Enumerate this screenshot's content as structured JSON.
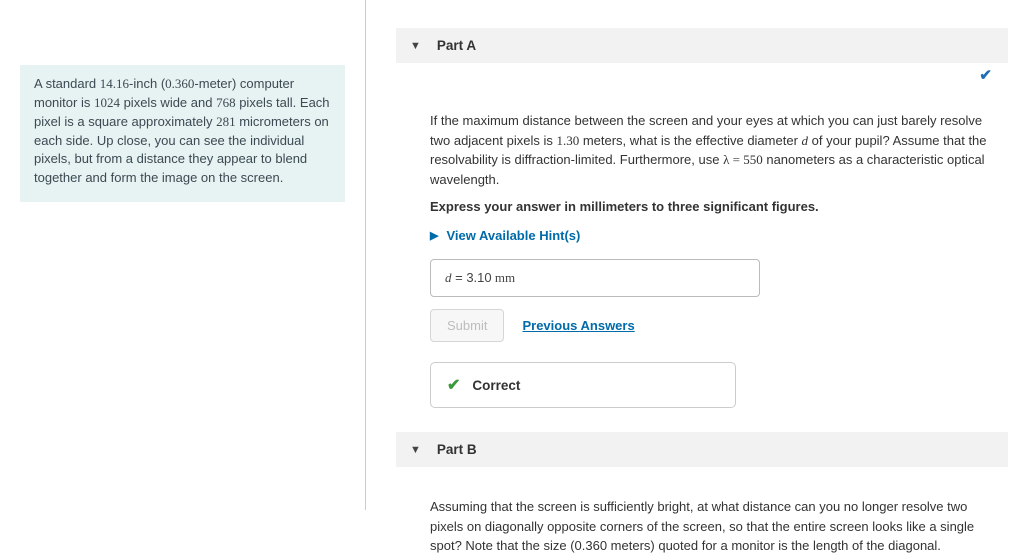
{
  "intro": {
    "pre1": "A standard ",
    "size_in": "14.16",
    "mid1": "-inch (",
    "size_m": "0.360",
    "mid2": "-meter) computer monitor is ",
    "px_w": "1024",
    "mid3": " pixels wide and ",
    "px_h": "768",
    "mid4": " pixels tall. Each pixel is a square approximately ",
    "um": "281",
    "post": " micrometers on each side. Up close, you can see the individual pixels, but from a distance they appear to blend together and form the image on the screen."
  },
  "partA": {
    "header": "Part A",
    "q_pre": "If the maximum distance between the screen and your eyes at which you can just barely resolve two adjacent pixels is ",
    "dist": "1.30",
    "q_mid": " meters, what is the effective diameter ",
    "var_d": "d",
    "q_mid2": " of your pupil? Assume that the resolvability is diffraction-limited. Furthermore, use ",
    "lambda": "λ = 550",
    "q_post": " nanometers as a characteristic optical wavelength.",
    "instruct": "Express your answer in millimeters to three significant figures.",
    "hints": "View Available Hint(s)",
    "ans_sym": "d",
    "ans_eq": " = ",
    "ans_val": "3.10",
    "ans_unit": "  mm",
    "submit": "Submit",
    "prev": "Previous Answers",
    "correct": "Correct"
  },
  "partB": {
    "header": "Part B",
    "q": "Assuming that the screen is sufficiently bright, at what distance can you no longer resolve two pixels on diagonally opposite corners of the screen, so that the entire screen looks like a single spot? Note that the size (0.360 meters) quoted for a monitor is the length of the diagonal."
  }
}
